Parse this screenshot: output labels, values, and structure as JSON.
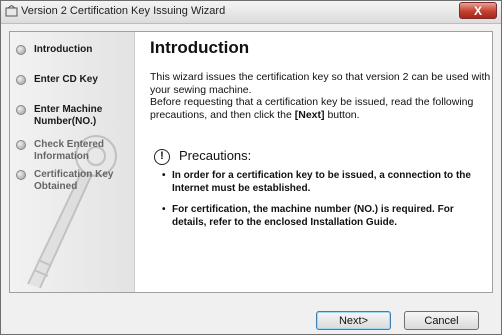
{
  "window": {
    "title": "Version 2 Certification Key Issuing Wizard",
    "close_label": "X"
  },
  "steps": [
    {
      "label": "Introduction",
      "active": true
    },
    {
      "label": "Enter CD Key",
      "active": false
    },
    {
      "label": "Enter Machine Number(NO.)",
      "active": false
    },
    {
      "label": "Check Entered Information",
      "active": false
    },
    {
      "label": "Certification Key Obtained",
      "active": false
    }
  ],
  "main": {
    "heading": "Introduction",
    "desc_1": "This wizard issues the certification key so that version 2 can be used with your sewing machine.",
    "desc_2a": "Before requesting that a certification key be issued, read the following precautions, and then click the ",
    "desc_2b": "[Next]",
    "desc_2c": " button.",
    "precautions_title": "Precautions:",
    "precautions_icon_glyph": "!",
    "precautions": [
      "In order for a certification key to be issued, a connection to the Internet must be established.",
      "For certification, the machine number (NO.) is required. For details, refer to the enclosed Installation Guide."
    ]
  },
  "buttons": {
    "next": "Next>",
    "cancel": "Cancel"
  }
}
